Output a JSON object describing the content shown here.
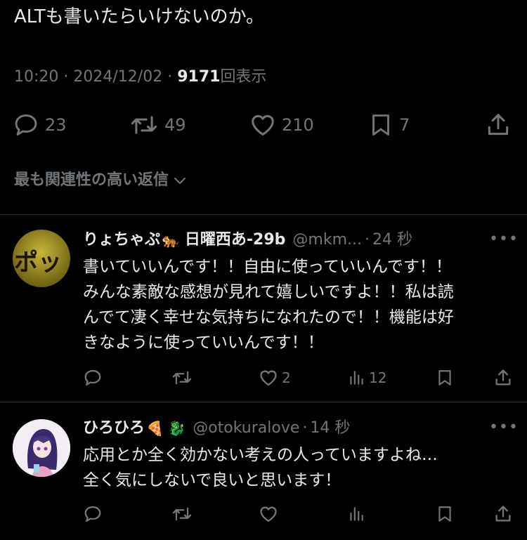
{
  "tweet": {
    "text": "ALTも書いたらいけないのか。",
    "time": "10:20",
    "date": "2024/12/02",
    "views_count": "9171",
    "views_label": "回表示",
    "replies": "23",
    "retweets": "49",
    "likes": "210",
    "bookmarks": "7"
  },
  "sort": {
    "label": "最も関連性の高い返信"
  },
  "replies": [
    {
      "name": "りょちゃぷ",
      "emoji": "🐅",
      "name_suffix": "日曜西あ-29b",
      "handle": "@mkm...",
      "time": "24 秒",
      "avatar_text": "ポッ",
      "text": "書いていいんです！！自由に使っていいんです！！\nみんな素敵な感想が見れて嬉しいですよ！！私は読\nんでて凄く幸せな気持ちになれたので！！機能は好\nきなように使っていいんです！！",
      "likes": "2",
      "views": "12"
    },
    {
      "name": "ひろひろ",
      "emoji": "🍕 🐉",
      "handle": "@otokuralove",
      "time": "14 秒",
      "text": "応用とか全く効かない考えの人っていますよね…\n全く気にしないで良いと思います！"
    }
  ],
  "colors": {
    "text": "#e7e9ea",
    "secondary": "#71767b",
    "divider": "#2f3336",
    "background": "#000000"
  }
}
